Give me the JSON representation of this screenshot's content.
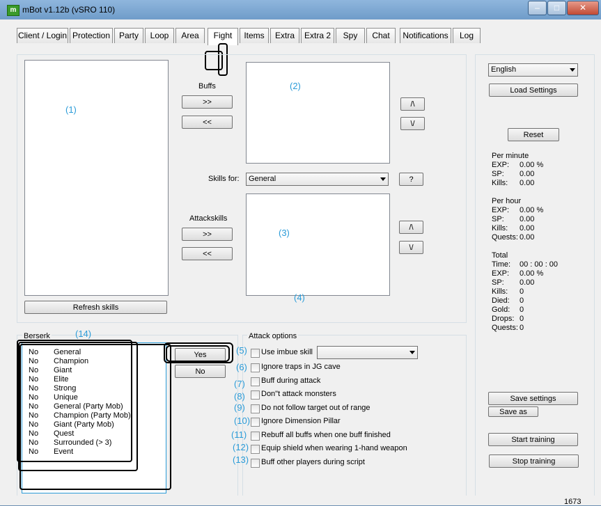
{
  "window": {
    "title": "mBot v1.12b (vSRO 110)",
    "minimize": "–",
    "maximize": "□",
    "close": "✕"
  },
  "tabs": [
    {
      "label": "Client / Login"
    },
    {
      "label": "Protection"
    },
    {
      "label": "Party"
    },
    {
      "label": "Loop"
    },
    {
      "label": "Area"
    },
    {
      "label": "Fight"
    },
    {
      "label": "Items"
    },
    {
      "label": "Extra"
    },
    {
      "label": "Extra 2"
    },
    {
      "label": "Spy"
    },
    {
      "label": "Chat"
    },
    {
      "label": "Notifications"
    },
    {
      "label": "Log"
    }
  ],
  "fight": {
    "buffs_label": "Buffs",
    "add_buff": ">>",
    "remove_buff": "<<",
    "up": "/\\",
    "down": "\\/",
    "skills_for_label": "Skills for:",
    "skills_for_value": "General",
    "help": "?",
    "attackskills_label": "Attackskills",
    "add_attack": ">>",
    "remove_attack": "<<",
    "refresh_skills": "Refresh skills"
  },
  "annotations": {
    "a1": "(1)",
    "a2": "(2)",
    "a3": "(3)",
    "a4": "(4)",
    "a5": "(5)",
    "a6": "(6)",
    "a7": "(7)",
    "a8": "(8)",
    "a9": "(9)",
    "a10": "(10)",
    "a11": "(11)",
    "a12": "(12)",
    "a13": "(13)",
    "a14": "(14)"
  },
  "berserk": {
    "title": "Berserk",
    "rows": [
      {
        "value": "No",
        "name": "General"
      },
      {
        "value": "No",
        "name": "Champion"
      },
      {
        "value": "No",
        "name": "Giant"
      },
      {
        "value": "No",
        "name": "Elite"
      },
      {
        "value": "No",
        "name": "Strong"
      },
      {
        "value": "No",
        "name": "Unique"
      },
      {
        "value": "No",
        "name": "General (Party Mob)"
      },
      {
        "value": "No",
        "name": "Champion (Party Mob)"
      },
      {
        "value": "No",
        "name": "Giant (Party Mob)"
      },
      {
        "value": "No",
        "name": "Quest"
      },
      {
        "value": "No",
        "name": "Surrounded (> 3)"
      },
      {
        "value": "No",
        "name": "Event"
      }
    ],
    "yes": "Yes",
    "no": "No"
  },
  "attack_options": {
    "title": "Attack options",
    "options": [
      "Use imbue skill",
      "Ignore traps in JG cave",
      "Buff during attack",
      "Don\"t attack monsters",
      "Do not follow target out of range",
      "Ignore Dimension Pillar",
      "Rebuff all buffs when one buff finished",
      "Equip shield when wearing 1-hand weapon",
      "Buff other players during script"
    ],
    "imbue_value": ""
  },
  "side": {
    "language": "English",
    "load_settings": "Load Settings",
    "reset": "Reset",
    "per_minute": {
      "title": "Per minute",
      "exp_k": "EXP:",
      "exp": "0.00 %",
      "sp_k": "SP:",
      "sp": "0.00",
      "kills_k": "Kills:",
      "kills": "0.00"
    },
    "per_hour": {
      "title": "Per hour",
      "exp_k": "EXP:",
      "exp": "0.00 %",
      "sp_k": "SP:",
      "sp": "0.00",
      "kills_k": "Kills:",
      "kills": "0.00",
      "quests_k": "Quests:",
      "quests": "0.00"
    },
    "total": {
      "title": "Total",
      "time_k": "Time:",
      "time": "00 : 00 : 00",
      "exp_k": "EXP:",
      "exp": "0.00 %",
      "sp_k": "SP:",
      "sp": "0.00",
      "kills_k": "Kills:",
      "kills": "0",
      "died_k": "Died:",
      "died": "0",
      "gold_k": "Gold:",
      "gold": "0",
      "drops_k": "Drops:",
      "drops": "0",
      "quests_k": "Quests:",
      "quests": "0"
    },
    "save_settings": "Save settings",
    "save_as": "Save as",
    "start_training": "Start training",
    "stop_training": "Stop training"
  },
  "status": {
    "counter": "1673"
  }
}
